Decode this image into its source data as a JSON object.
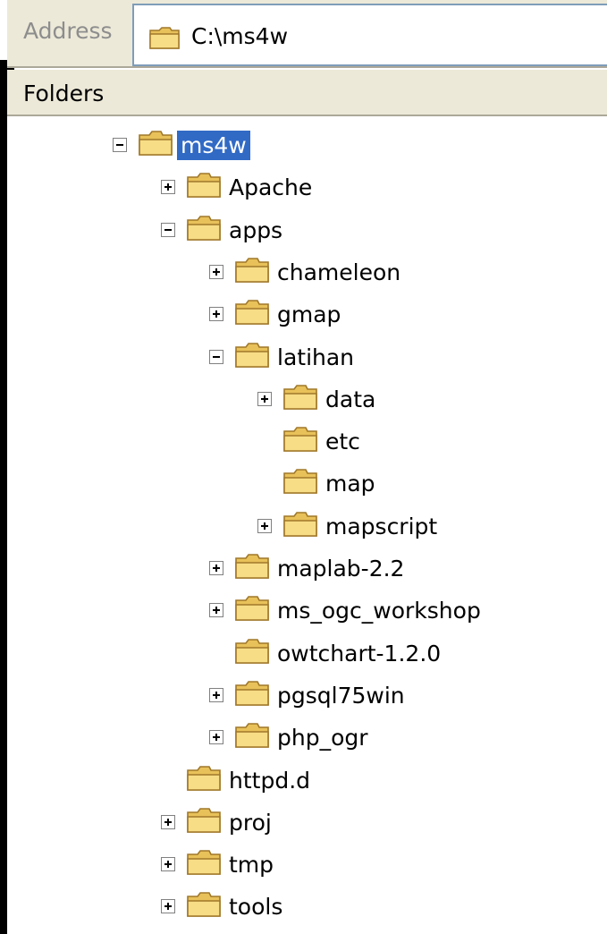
{
  "address": {
    "label": "Address",
    "path": "C:\\ms4w"
  },
  "folders_header": "Folders",
  "tree": [
    {
      "label": "ms4w",
      "state": "expanded",
      "depth": 0,
      "selected": true
    },
    {
      "label": "Apache",
      "state": "collapsed",
      "depth": 1
    },
    {
      "label": "apps",
      "state": "expanded",
      "depth": 1
    },
    {
      "label": "chameleon",
      "state": "collapsed",
      "depth": 2
    },
    {
      "label": "gmap",
      "state": "collapsed",
      "depth": 2
    },
    {
      "label": "latihan",
      "state": "expanded",
      "depth": 2
    },
    {
      "label": "data",
      "state": "collapsed",
      "depth": 3
    },
    {
      "label": "etc",
      "state": "none",
      "depth": 3
    },
    {
      "label": "map",
      "state": "none",
      "depth": 3
    },
    {
      "label": "mapscript",
      "state": "collapsed",
      "depth": 3
    },
    {
      "label": "maplab-2.2",
      "state": "collapsed",
      "depth": 2
    },
    {
      "label": "ms_ogc_workshop",
      "state": "collapsed",
      "depth": 2
    },
    {
      "label": "owtchart-1.2.0",
      "state": "none",
      "depth": 2
    },
    {
      "label": "pgsql75win",
      "state": "collapsed",
      "depth": 2
    },
    {
      "label": "php_ogr",
      "state": "collapsed",
      "depth": 2
    },
    {
      "label": "httpd.d",
      "state": "none",
      "depth": 1
    },
    {
      "label": "proj",
      "state": "collapsed",
      "depth": 1
    },
    {
      "label": "tmp",
      "state": "collapsed",
      "depth": 1
    },
    {
      "label": "tools",
      "state": "collapsed",
      "depth": 1
    }
  ],
  "colors": {
    "selection": "#316ac5",
    "folder": "#f5d77a",
    "chrome": "#ece9d8"
  },
  "icons": {
    "folder": "folder-icon",
    "expand": "plus-box-icon",
    "collapse": "minus-box-icon"
  }
}
